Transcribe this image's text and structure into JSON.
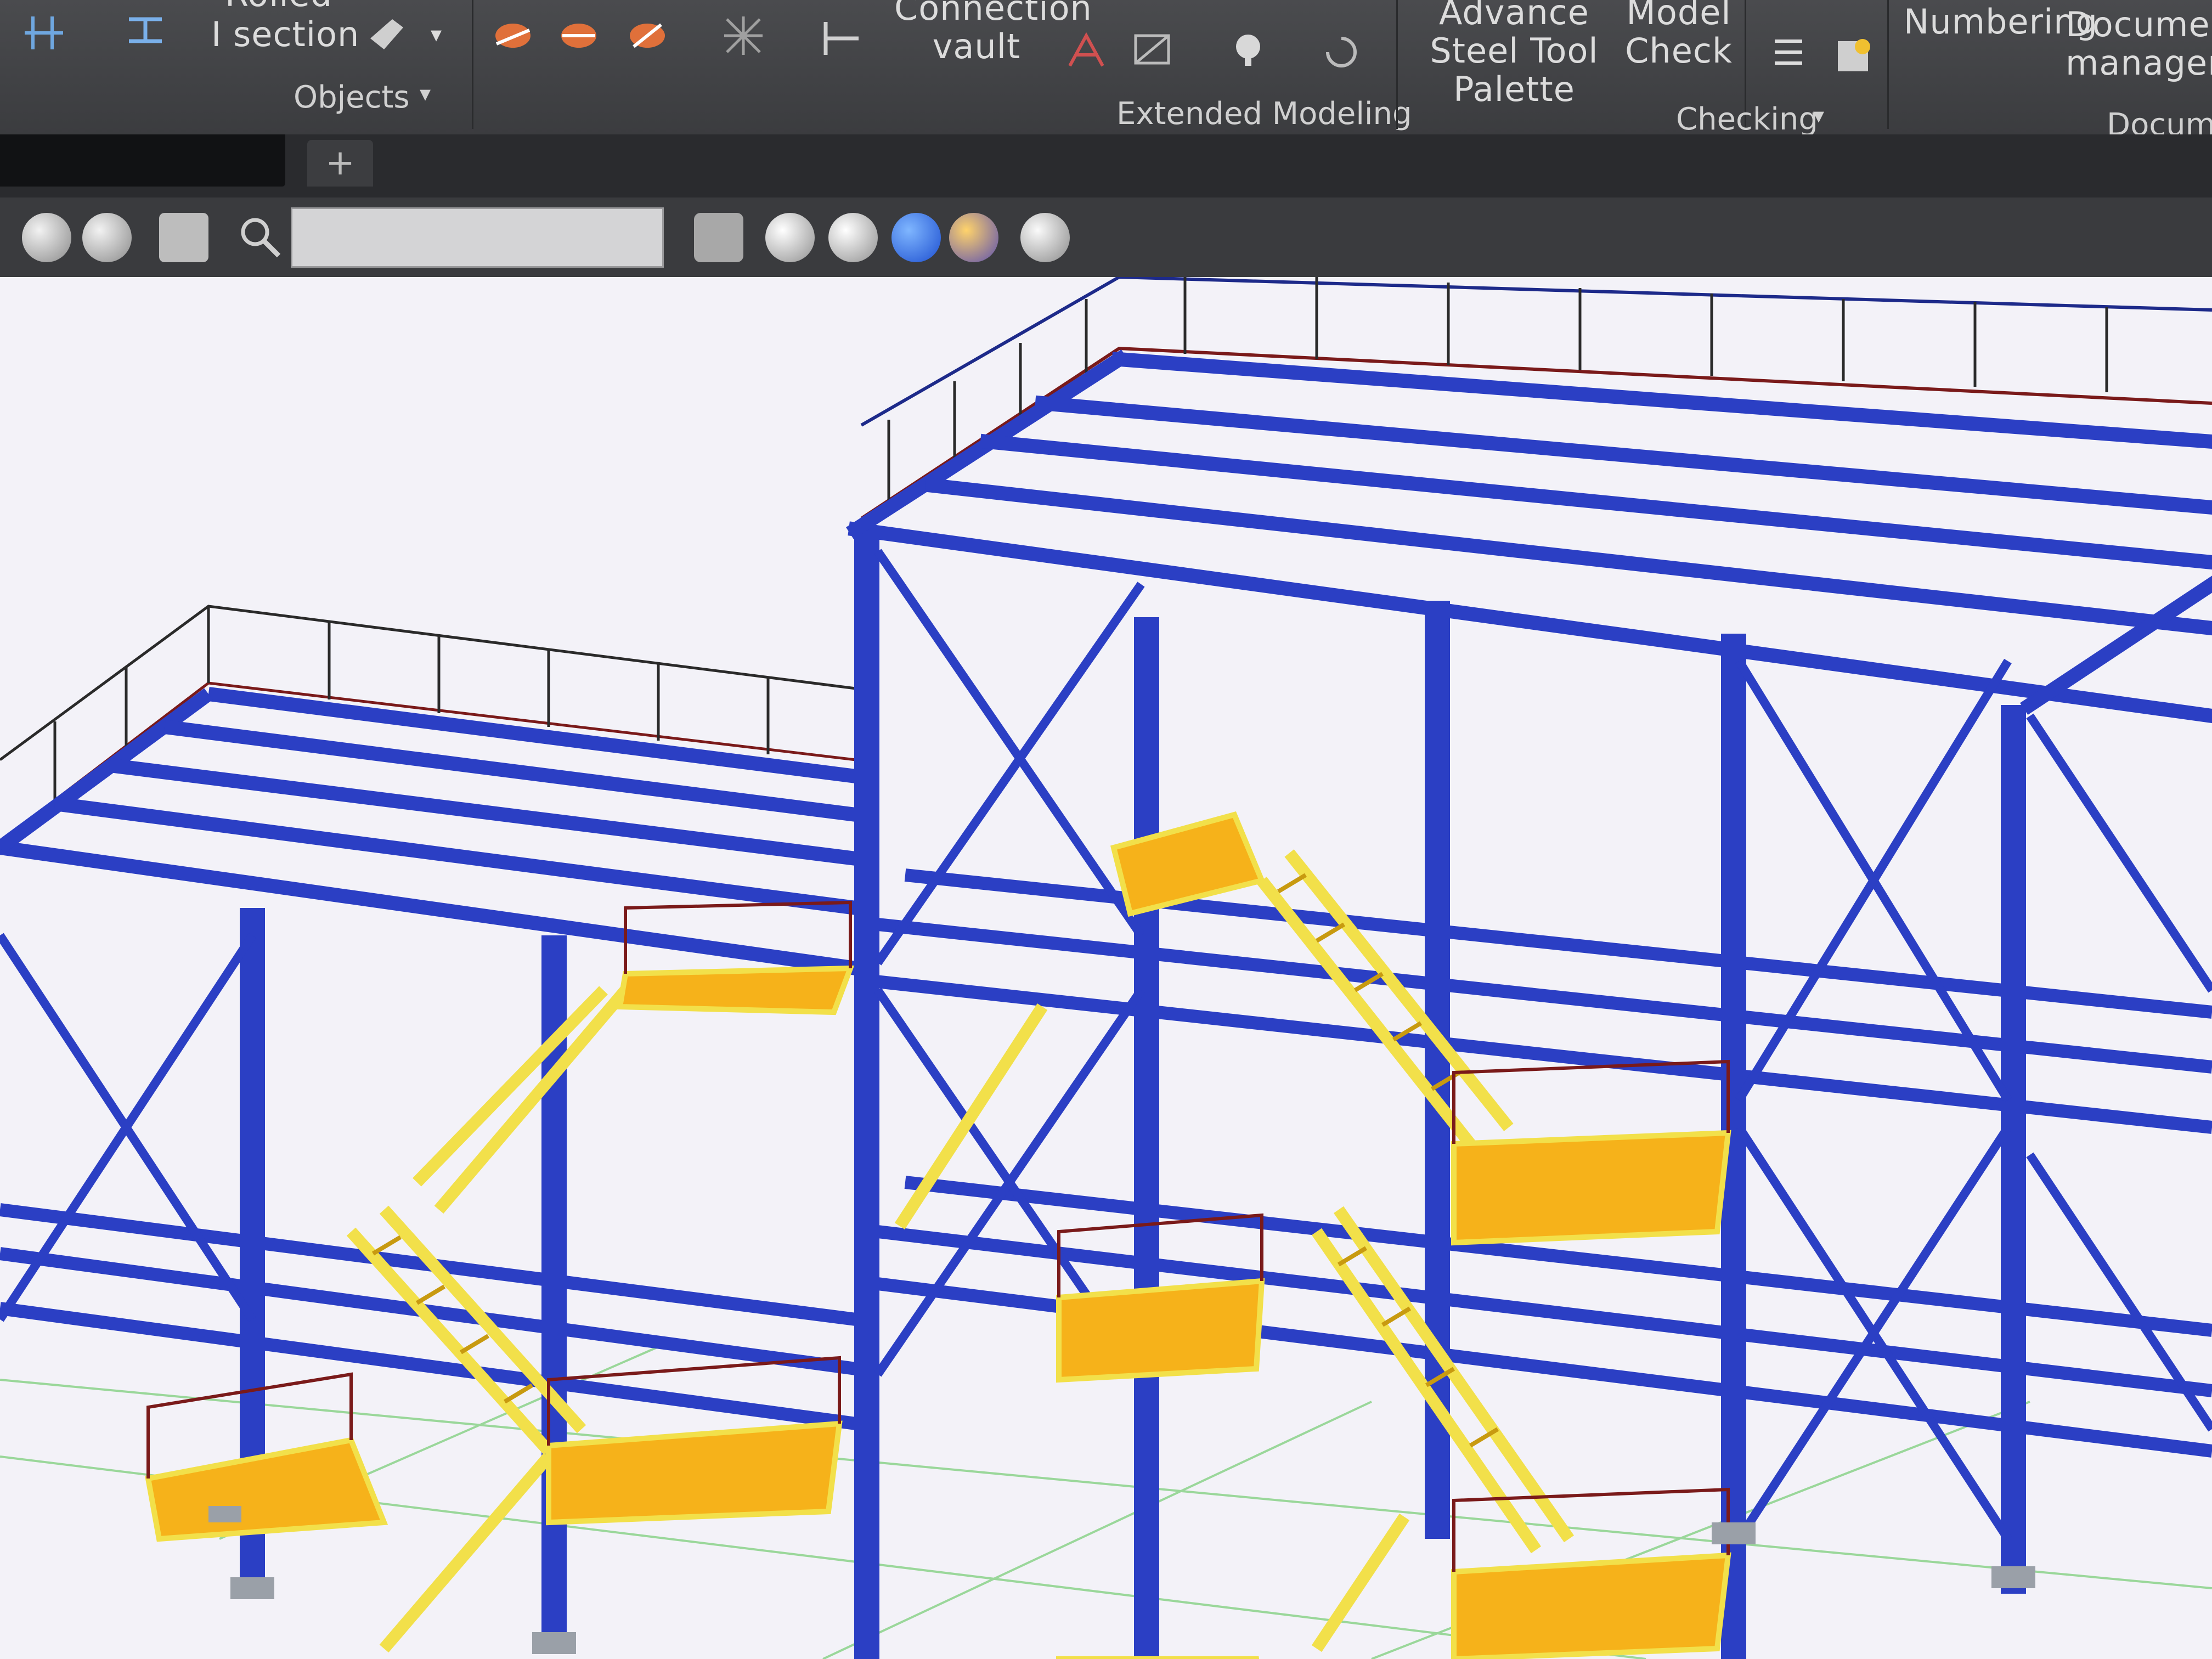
{
  "ribbon": {
    "objects_group": {
      "rolled_label": "Rolled",
      "section_label": "I section",
      "group_label": "Objects"
    },
    "connection_vault_label": "Connection vault",
    "extended_modeling_group_label": "Extended Modeling",
    "tool_palette_label": "Advance Steel Tool Palette",
    "model_check_label": "Model Check",
    "checking_group_label": "Checking",
    "numbering_label": "Numbering",
    "document_manager_label": "Document manager",
    "documents_group_label": "Docume"
  },
  "tabs": {
    "add_tab_label": "+"
  },
  "colors": {
    "ribbon_bg": "#3f4043",
    "viewport_bg": "#f3f2f8",
    "steel_blue": "#2b3fc4",
    "stair_yellow": "#f2e04a",
    "platform_orange": "#f6b21a",
    "railing_red": "#7a1a1a",
    "ground_grid": "#9ad79a"
  }
}
